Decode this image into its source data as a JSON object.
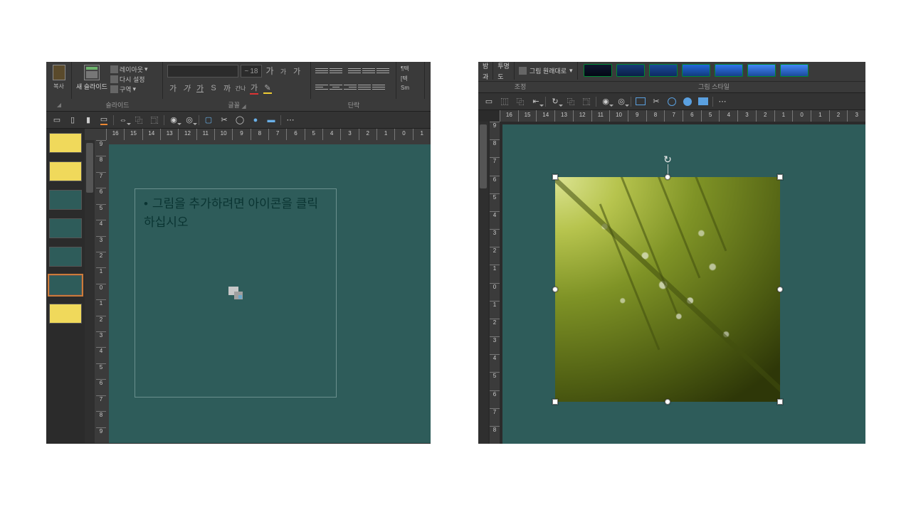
{
  "left": {
    "clipboard_label": "복사",
    "slide_group_label": "슬라이드",
    "new_slide": "새 슬라이드",
    "layout": "레이아웃",
    "reset": "다시 설정",
    "section": "구역",
    "font_group_label": "글꼴",
    "font_size": "18",
    "font_increase": "가",
    "font_decrease": "가",
    "font_clear": "가",
    "btn_bold": "가",
    "btn_italic": "가",
    "btn_underline": "가",
    "btn_strike": "S",
    "btn_shadow": "까",
    "btn_spacing": "간나",
    "para_group_label": "단락",
    "txtdir": "텍",
    "txtalign": "텍",
    "sm": "Sm",
    "ruler_h": [
      "16",
      "15",
      "14",
      "13",
      "12",
      "11",
      "10",
      "9",
      "8",
      "7",
      "6",
      "5",
      "4",
      "3",
      "2",
      "1",
      "0",
      "1"
    ],
    "ruler_v": [
      "9",
      "8",
      "7",
      "6",
      "5",
      "4",
      "3",
      "2",
      "1",
      "0",
      "1",
      "2",
      "3",
      "4",
      "5",
      "6",
      "7",
      "8",
      "9"
    ],
    "placeholder_text": "그림을 추가하려면 아이콘을 클릭하십시오"
  },
  "right": {
    "col1a": "밤",
    "col1b": "과",
    "col2a": "투명",
    "col2b": "도",
    "reset_pic": "그림 원래대로",
    "adjust_label": "조정",
    "style_label": "그림 스타일",
    "ruler_h": [
      "16",
      "15",
      "14",
      "13",
      "12",
      "11",
      "10",
      "9",
      "8",
      "7",
      "6",
      "5",
      "4",
      "3",
      "2",
      "1",
      "0",
      "1",
      "2",
      "3"
    ],
    "ruler_v": [
      "9",
      "8",
      "7",
      "6",
      "5",
      "4",
      "3",
      "2",
      "1",
      "0",
      "1",
      "2",
      "3",
      "4",
      "5",
      "6",
      "7",
      "8"
    ]
  }
}
